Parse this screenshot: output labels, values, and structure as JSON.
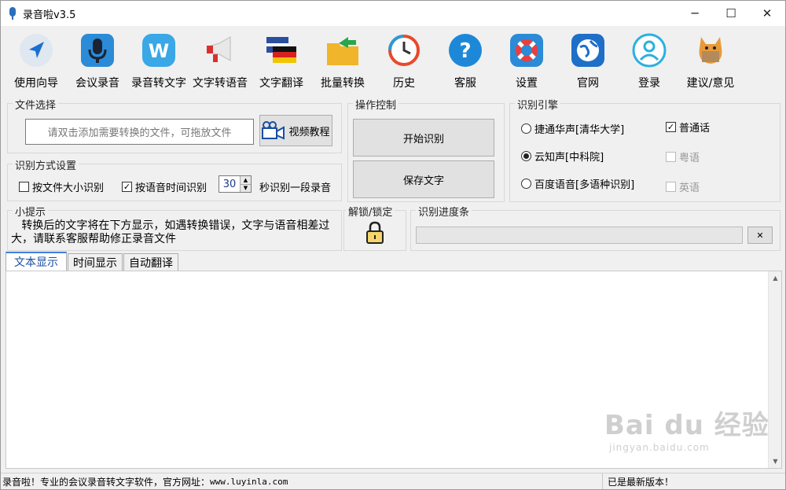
{
  "window": {
    "title": "录音啦v3.5",
    "minimize": "─",
    "maximize": "☐",
    "close": "✕"
  },
  "toolbar": [
    {
      "label": "使用向导",
      "icon": "navigation-arrow-icon"
    },
    {
      "label": "会议录音",
      "icon": "microphone-icon"
    },
    {
      "label": "录音转文字",
      "icon": "w-letter-icon"
    },
    {
      "label": "文字转语音",
      "icon": "megaphone-icon"
    },
    {
      "label": "文字翻译",
      "icon": "flags-icon"
    },
    {
      "label": "批量转换",
      "icon": "folder-arrow-icon"
    },
    {
      "label": "历史",
      "icon": "history-clock-icon"
    },
    {
      "label": "客服",
      "icon": "question-icon"
    },
    {
      "label": "设置",
      "icon": "lifebuoy-icon"
    },
    {
      "label": "官网",
      "icon": "globe-icon"
    },
    {
      "label": "登录",
      "icon": "user-icon"
    },
    {
      "label": "建议/意见",
      "icon": "cat-icon"
    }
  ],
  "file_select": {
    "title": "文件选择",
    "placeholder": "请双击添加需要转换的文件，可拖放文件",
    "video_button": "视频教程"
  },
  "operation": {
    "title": "操作控制",
    "start": "开始识别",
    "save": "保存文字"
  },
  "engine": {
    "title": "识别引擎",
    "options": [
      {
        "label": "捷通华声[清华大学]",
        "selected": false
      },
      {
        "label": "云知声[中科院]",
        "selected": true
      },
      {
        "label": "百度语音[多语种识别]",
        "selected": false
      }
    ],
    "languages": [
      {
        "label": "普通话",
        "checked": true,
        "enabled": true
      },
      {
        "label": "粤语",
        "checked": false,
        "enabled": false
      },
      {
        "label": "英语",
        "checked": false,
        "enabled": false
      }
    ]
  },
  "mode": {
    "title": "识别方式设置",
    "by_size": "按文件大小识别",
    "by_size_checked": false,
    "by_time": "按语音时间识别",
    "by_time_checked": true,
    "seconds": "30",
    "suffix": "秒识别一段录音"
  },
  "tips": {
    "title": "小提示",
    "text": "   转换后的文字将在下方显示，如遇转换错误，文字与语音相差过大，请联系客服帮助修正录音文件"
  },
  "lock": {
    "title": "解锁/锁定"
  },
  "progress": {
    "title": "识别进度条",
    "value": 0,
    "clear": "✕"
  },
  "tabs": [
    {
      "label": "文本显示",
      "active": true
    },
    {
      "label": "时间显示",
      "active": false
    },
    {
      "label": "自动翻译",
      "active": false
    }
  ],
  "status": {
    "left": "录音啦！专业的会议录音转文字软件，官方网址：",
    "url": "www.luyinla.com",
    "right": "已是最新版本！"
  },
  "watermark": {
    "big": "Bai du 经验",
    "small": "jingyan.baidu.com"
  },
  "colors": {
    "accent": "#1a8ad4",
    "tab_active": "#1a4fa0"
  }
}
